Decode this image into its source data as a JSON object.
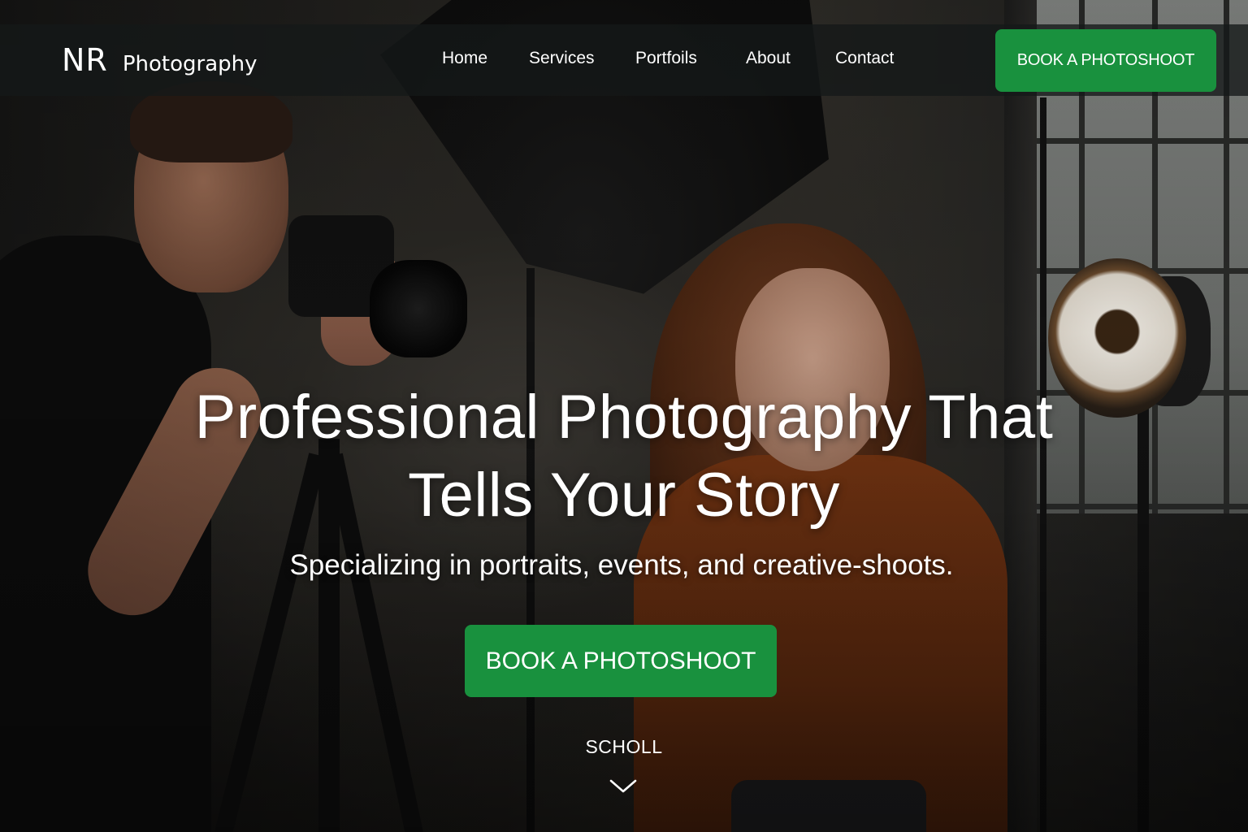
{
  "brand": {
    "mark": "NR",
    "name": "Photography"
  },
  "nav": {
    "links": [
      {
        "label": "Home"
      },
      {
        "label": "Services"
      },
      {
        "label": "Portfoils"
      },
      {
        "label": "About"
      },
      {
        "label": "Contact"
      }
    ],
    "cta_label": "BOOK A PHOTOSHOOT"
  },
  "hero": {
    "title_line1": "Professional Photography That",
    "title_line2": "Tells Your Story",
    "subtitle": "Specializing in portraits, events, and creative-shoots.",
    "cta_label": "BOOK A PHOTOSHOOT",
    "scroll_label": "SCHOLL",
    "scroll_icon": "chevron-down-icon"
  },
  "colors": {
    "accent": "#19913e",
    "nav_background": "#141818",
    "text": "#ffffff"
  }
}
